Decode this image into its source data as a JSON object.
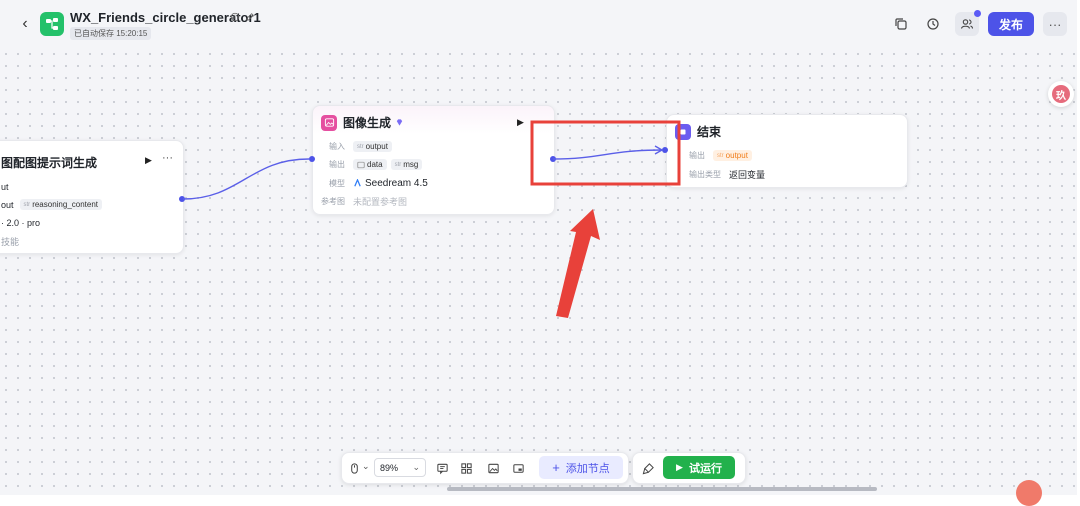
{
  "header": {
    "app_title": "WX_Friends_circle_generator1",
    "autosave_text": "已自动保存 15:20:15",
    "publish_label": "发布",
    "more_label": "···"
  },
  "nodes": {
    "prompt_node": {
      "title": "图配图提示词生成",
      "row1_value": "ut",
      "row2_tag1": "out",
      "row2_tag2": "reasoning_content",
      "row2_tag2_type": "str",
      "row3_value": "· 2.0 · pro",
      "row4_value": "技能"
    },
    "image_gen": {
      "title": "图像生成",
      "input_label": "输入",
      "input_type": "str",
      "input_value": "output",
      "output_label": "输出",
      "output_data": "data",
      "output_msg_type": "str",
      "output_msg": "msg",
      "model_label": "模型",
      "model_value": "Seedream 4.5",
      "ref_label": "参考图",
      "ref_value": "未配置参考图"
    },
    "end_node": {
      "title": "结束",
      "output_label": "输出",
      "output_type": "str",
      "output_value": "output",
      "output_var_label": "输出类型",
      "output_var_value": "返回变量"
    }
  },
  "toolbar": {
    "zoom_value": "89%",
    "add_node_label": "添加节点",
    "run_label": "试运行"
  },
  "floating": {
    "avatar_letter": "玖"
  },
  "colors": {
    "accent": "#4d53e8",
    "run_green": "#22b14c",
    "annotation_red": "#e8413a"
  }
}
